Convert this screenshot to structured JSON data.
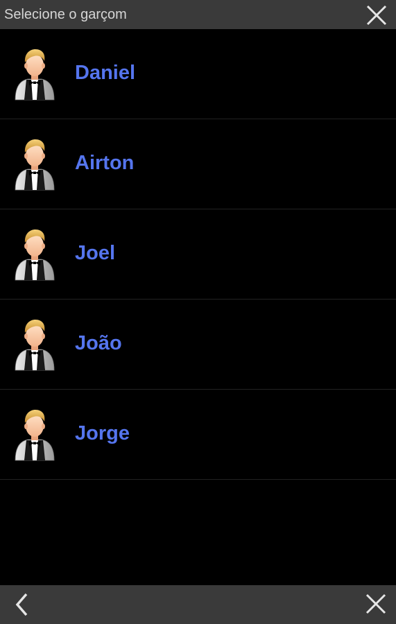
{
  "header": {
    "title": "Selecione o garçom",
    "close_icon": "close-icon"
  },
  "waiters": [
    {
      "name": "Daniel",
      "icon": "waiter-avatar-icon"
    },
    {
      "name": "Airton",
      "icon": "waiter-avatar-icon"
    },
    {
      "name": "Joel",
      "icon": "waiter-avatar-icon"
    },
    {
      "name": "João",
      "icon": "waiter-avatar-icon"
    },
    {
      "name": "Jorge",
      "icon": "waiter-avatar-icon"
    }
  ],
  "footer": {
    "back_icon": "chevron-left-icon",
    "close_icon": "close-icon"
  },
  "colors": {
    "background": "#000000",
    "bar": "#3a3a3a",
    "name_text": "#5575ee",
    "title_text": "#d6d6d6"
  }
}
